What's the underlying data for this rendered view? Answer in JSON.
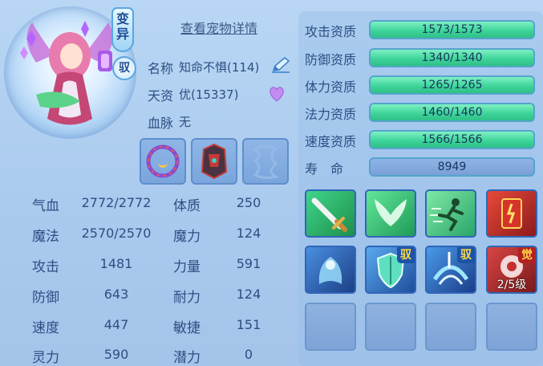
{
  "pet": {
    "variant_label": "变异",
    "tame_label": "驭",
    "detail_link": "查看宠物详情",
    "name_key": "名称",
    "name_value": "知命不惧(114)",
    "aptitude_key": "天资",
    "aptitude_value": "优(15337)",
    "bloodline_key": "血脉",
    "bloodline_value": "无"
  },
  "stats": [
    {
      "key": "气血",
      "value": "2772/2772",
      "key2": "体质",
      "value2": "250"
    },
    {
      "key": "魔法",
      "value": "2570/2570",
      "key2": "魔力",
      "value2": "124"
    },
    {
      "key": "攻击",
      "value": "1481",
      "key2": "力量",
      "value2": "591"
    },
    {
      "key": "防御",
      "value": "643",
      "key2": "耐力",
      "value2": "124"
    },
    {
      "key": "速度",
      "value": "447",
      "key2": "敏捷",
      "value2": "151"
    },
    {
      "key": "灵力",
      "value": "590",
      "key2": "潜力",
      "value2": "0"
    }
  ],
  "aptitudes": [
    {
      "name": "攻击资质",
      "value": "1573/1573",
      "fraction": 1.0
    },
    {
      "name": "防御资质",
      "value": "1340/1340",
      "fraction": 1.0
    },
    {
      "name": "体力资质",
      "value": "1265/1265",
      "fraction": 1.0
    },
    {
      "name": "法力资质",
      "value": "1460/1460",
      "fraction": 1.0
    },
    {
      "name": "速度资质",
      "value": "1566/1566",
      "fraction": 1.0
    }
  ],
  "lifespan": {
    "name": "寿　命",
    "value": "8949"
  },
  "skills": [
    {
      "icon": "sword-skill-icon",
      "tag": ""
    },
    {
      "icon": "wings-skill-icon",
      "tag": ""
    },
    {
      "icon": "dash-skill-icon",
      "tag": ""
    },
    {
      "icon": "scroll-skill-icon",
      "tag": ""
    },
    {
      "icon": "spirit-skill-icon",
      "tag": ""
    },
    {
      "icon": "shield-skill-icon",
      "tag": "驭"
    },
    {
      "icon": "whirl-skill-icon",
      "tag": "驭"
    },
    {
      "icon": "awaken-skill-icon",
      "tag": "觉",
      "level": "2/5级"
    }
  ],
  "colors": {
    "accent": "#2e4e83",
    "bar_green": "#3fd59a",
    "panel": "#a9c9ee"
  }
}
